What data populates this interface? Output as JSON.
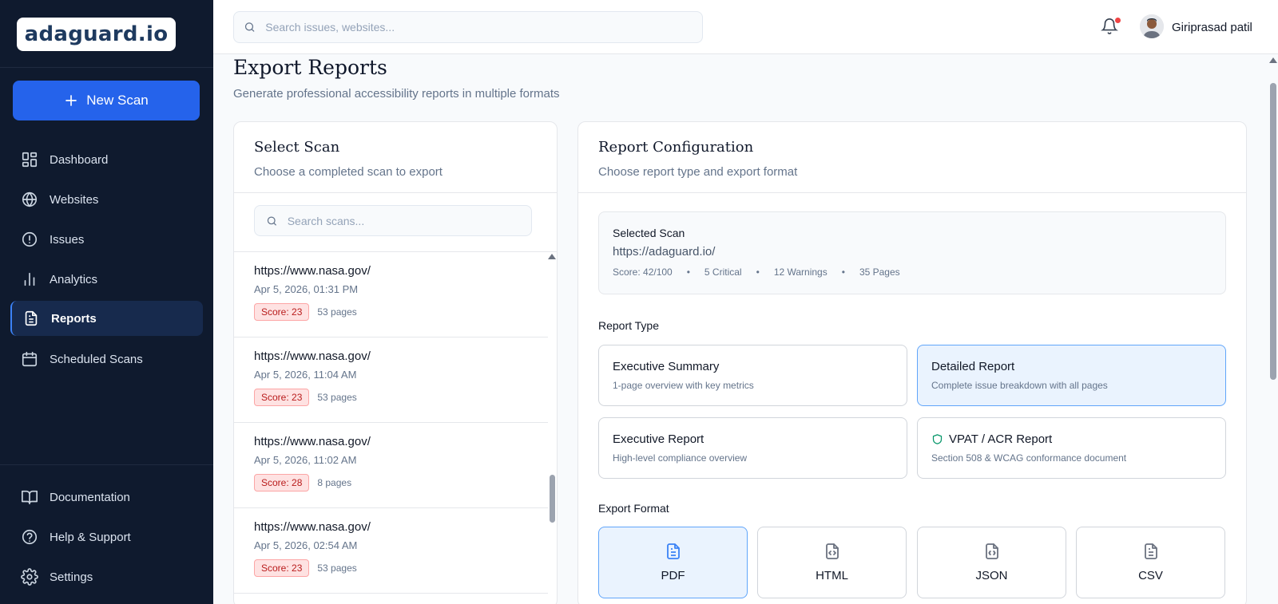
{
  "app": {
    "logo_text": "adaguard.io",
    "logo_glyph": "◈"
  },
  "sidebar": {
    "new_scan_label": "New Scan",
    "nav": [
      {
        "label": "Dashboard",
        "icon": "dashboard-icon"
      },
      {
        "label": "Websites",
        "icon": "globe-icon"
      },
      {
        "label": "Issues",
        "icon": "alert-circle-icon"
      },
      {
        "label": "Analytics",
        "icon": "bar-chart-icon"
      },
      {
        "label": "Reports",
        "icon": "file-text-icon",
        "active": true
      },
      {
        "label": "Scheduled Scans",
        "icon": "calendar-icon"
      }
    ],
    "bottom_nav": [
      {
        "label": "Documentation",
        "icon": "book-icon"
      },
      {
        "label": "Help & Support",
        "icon": "help-circle-icon"
      },
      {
        "label": "Settings",
        "icon": "gear-icon"
      }
    ]
  },
  "topbar": {
    "search_placeholder": "Search issues, websites...",
    "user_name": "Giriprasad patil"
  },
  "page": {
    "title": "Export Reports",
    "subtitle": "Generate professional accessibility reports in multiple formats"
  },
  "select_scan": {
    "title": "Select Scan",
    "subtitle": "Choose a completed scan to export",
    "search_placeholder": "Search scans...",
    "scans": [
      {
        "url": "https://www.nasa.gov/",
        "date": "Apr 5, 2026, 01:31 PM",
        "score": "Score: 23",
        "pages": "53 pages"
      },
      {
        "url": "https://www.nasa.gov/",
        "date": "Apr 5, 2026, 11:04 AM",
        "score": "Score: 23",
        "pages": "53 pages"
      },
      {
        "url": "https://www.nasa.gov/",
        "date": "Apr 5, 2026, 11:02 AM",
        "score": "Score: 28",
        "pages": "8 pages"
      },
      {
        "url": "https://www.nasa.gov/",
        "date": "Apr 5, 2026, 02:54 AM",
        "score": "Score: 23",
        "pages": "53 pages"
      }
    ]
  },
  "report_config": {
    "title": "Report Configuration",
    "subtitle": "Choose report type and export format",
    "selected_scan": {
      "label": "Selected Scan",
      "url": "https://adaguard.io/",
      "score": "Score: 42/100",
      "critical": "5 Critical",
      "warnings": "12 Warnings",
      "pages": "35 Pages",
      "separator": "•"
    },
    "report_type_label": "Report Type",
    "report_types": [
      {
        "title": "Executive Summary",
        "desc": "1-page overview with key metrics",
        "active": false
      },
      {
        "title": "Detailed Report",
        "desc": "Complete issue breakdown with all pages",
        "active": true
      },
      {
        "title": "Executive Report",
        "desc": "High-level compliance overview",
        "active": false
      },
      {
        "title": "VPAT / ACR Report",
        "desc": "Section 508 & WCAG conformance document",
        "active": false,
        "icon": "shield-icon"
      }
    ],
    "export_format_label": "Export Format",
    "formats": [
      {
        "label": "PDF",
        "icon": "file-text-icon",
        "active": true
      },
      {
        "label": "HTML",
        "icon": "file-code-icon",
        "active": false
      },
      {
        "label": "JSON",
        "icon": "file-json-icon",
        "active": false
      },
      {
        "label": "CSV",
        "icon": "file-spreadsheet-icon",
        "active": false
      }
    ]
  },
  "colors": {
    "sidebar_bg": "#0f1a2e",
    "primary": "#2563eb",
    "active_card_bg": "#eaf3fe",
    "score_badge_bg": "#fee2e2",
    "notification_dot": "#ef4444"
  }
}
